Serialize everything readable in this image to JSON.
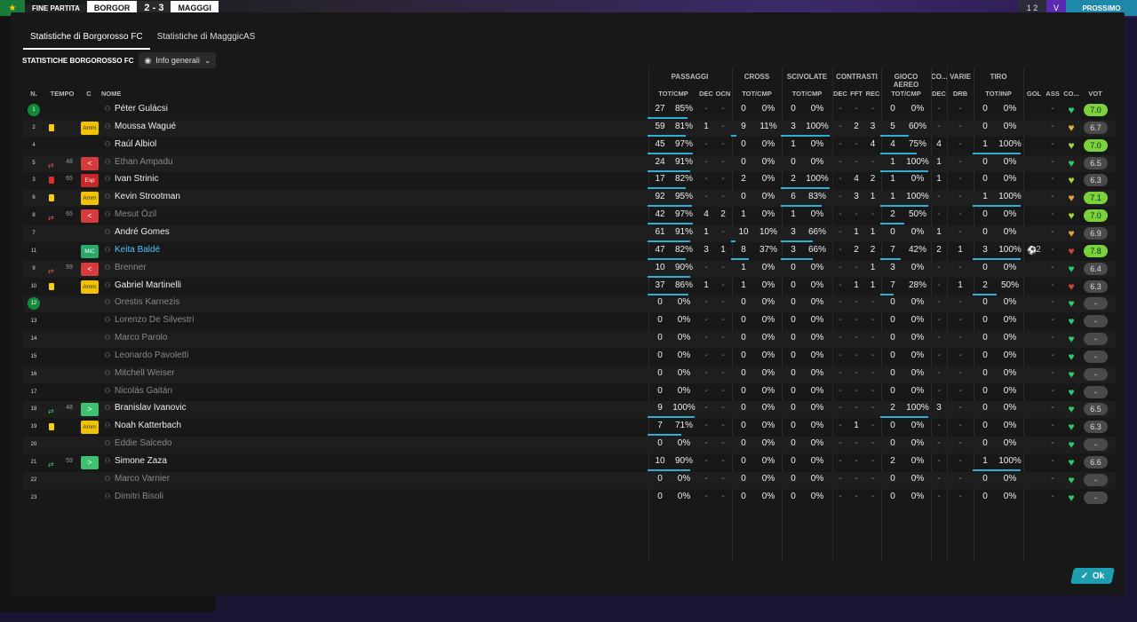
{
  "topbar": {
    "end_label": "FINE PARTITA",
    "home_team": "BORGOR",
    "score": "2 - 3",
    "away_team": "MAGGGI",
    "right_a": "1 2",
    "right_b": "V",
    "right_c": "PROSSIMO"
  },
  "tabs": [
    {
      "label": "Statistiche di Borgorosso FC"
    },
    {
      "label": "Statistiche di MagggicAS"
    }
  ],
  "section_title": "STATISTICHE BORGOROSSO FC",
  "view_dropdown": {
    "selected": "Info generali"
  },
  "groups": {
    "passaggi": "PASSAGGI",
    "cross": "CROSS",
    "scivolate": "SCIVOLATE",
    "contrasti": "CONTRASTI",
    "aereo": "GIOCO AEREO",
    "co": "CO...",
    "varie": "VARIE",
    "tiro": "TIRO"
  },
  "headers": {
    "n": "N.",
    "tempo": "TEMPO",
    "c": "C",
    "nome": "NOME",
    "pass_tot": "TOT/CMP",
    "pass_dec": "DEC",
    "pass_ocn": "OCN",
    "cross_tot": "TOT/CMP",
    "sciv_tot": "TOT/CMP",
    "con_dec": "DEC",
    "con_fft": "FFT",
    "con_rec": "REC",
    "aer_tot": "TOT/CMP",
    "co_dec": "DEC",
    "var_drb": "DRB",
    "tiro_tot": "TOT/INP",
    "gol": "GOL",
    "ass": "ASS",
    "co": "CO...",
    "vot": "VOT"
  },
  "ok_label": "Ok",
  "players": [
    {
      "n": "1",
      "starter": true,
      "card": "",
      "min": "",
      "badge": "",
      "badge_label": "",
      "name": "Péter Gulácsi",
      "dim": false,
      "link": false,
      "p_tot": "27",
      "p_pct": "85%",
      "p_dec": "-",
      "p_ocn": "-",
      "c_tot": "0",
      "c_pct": "0%",
      "s_tot": "0",
      "s_pct": "0%",
      "k_dec": "-",
      "k_fft": "-",
      "k_rec": "-",
      "a_tot": "0",
      "a_pct": "0%",
      "co": "-",
      "drb": "-",
      "t_tot": "0",
      "t_pct": "0%",
      "gol": "",
      "ass": "-",
      "heart": "green",
      "rating": "7.0",
      "rt": "green"
    },
    {
      "n": "2",
      "starter": false,
      "card": "y",
      "min": "",
      "badge": "amm",
      "badge_label": "Amm",
      "name": "Moussa Wagué",
      "dim": false,
      "link": false,
      "p_tot": "59",
      "p_pct": "81%",
      "p_dec": "1",
      "p_ocn": "-",
      "c_tot": "9",
      "c_pct": "11%",
      "s_tot": "3",
      "s_pct": "100%",
      "k_dec": "-",
      "k_fft": "2",
      "k_rec": "3",
      "a_tot": "5",
      "a_pct": "60%",
      "co": "-",
      "drb": "-",
      "t_tot": "0",
      "t_pct": "0%",
      "gol": "",
      "ass": "-",
      "heart": "yellow",
      "rating": "6.7",
      "rt": "grey"
    },
    {
      "n": "4",
      "starter": false,
      "card": "",
      "min": "",
      "badge": "",
      "badge_label": "",
      "name": "Raúl Albiol",
      "dim": false,
      "link": false,
      "p_tot": "45",
      "p_pct": "97%",
      "p_dec": "-",
      "p_ocn": "-",
      "c_tot": "0",
      "c_pct": "0%",
      "s_tot": "1",
      "s_pct": "0%",
      "k_dec": "-",
      "k_fft": "-",
      "k_rec": "4",
      "a_tot": "4",
      "a_pct": "75%",
      "co": "4",
      "drb": "-",
      "t_tot": "1",
      "t_pct": "100%",
      "gol": "",
      "ass": "-",
      "heart": "lime",
      "rating": "7.0",
      "rt": "green"
    },
    {
      "n": "5",
      "starter": false,
      "card": "",
      "min": "48",
      "swap": "out",
      "badge": "out",
      "badge_label": "<",
      "name": "Ethan Ampadu",
      "dim": true,
      "link": false,
      "p_tot": "24",
      "p_pct": "91%",
      "p_dec": "-",
      "p_ocn": "-",
      "c_tot": "0",
      "c_pct": "0%",
      "s_tot": "0",
      "s_pct": "0%",
      "k_dec": "-",
      "k_fft": "-",
      "k_rec": "-",
      "a_tot": "1",
      "a_pct": "100%",
      "co": "1",
      "drb": "-",
      "t_tot": "0",
      "t_pct": "0%",
      "gol": "",
      "ass": "-",
      "heart": "green",
      "rating": "6.5",
      "rt": "grey"
    },
    {
      "n": "3",
      "starter": false,
      "card": "r",
      "min": "65",
      "badge": "esp",
      "badge_label": "Esp",
      "name": "Ivan Strinic",
      "dim": false,
      "link": false,
      "p_tot": "17",
      "p_pct": "82%",
      "p_dec": "-",
      "p_ocn": "-",
      "c_tot": "2",
      "c_pct": "0%",
      "s_tot": "2",
      "s_pct": "100%",
      "k_dec": "-",
      "k_fft": "4",
      "k_rec": "2",
      "a_tot": "1",
      "a_pct": "0%",
      "co": "1",
      "drb": "-",
      "t_tot": "0",
      "t_pct": "0%",
      "gol": "",
      "ass": "-",
      "heart": "lime",
      "rating": "6.3",
      "rt": "grey"
    },
    {
      "n": "6",
      "starter": false,
      "card": "y",
      "min": "",
      "badge": "amm",
      "badge_label": "Amm",
      "name": "Kevin Strootman",
      "dim": false,
      "link": false,
      "p_tot": "92",
      "p_pct": "95%",
      "p_dec": "-",
      "p_ocn": "-",
      "c_tot": "0",
      "c_pct": "0%",
      "s_tot": "6",
      "s_pct": "83%",
      "k_dec": "-",
      "k_fft": "3",
      "k_rec": "1",
      "a_tot": "1",
      "a_pct": "100%",
      "co": "-",
      "drb": "-",
      "t_tot": "1",
      "t_pct": "100%",
      "gol": "",
      "ass": "-",
      "heart": "orange",
      "rating": "7.1",
      "rt": "green"
    },
    {
      "n": "8",
      "starter": false,
      "card": "",
      "min": "65",
      "swap": "out",
      "badge": "out",
      "badge_label": "<",
      "name": "Mesut Özil",
      "dim": true,
      "link": false,
      "p_tot": "42",
      "p_pct": "97%",
      "p_dec": "4",
      "p_ocn": "2",
      "c_tot": "1",
      "c_pct": "0%",
      "s_tot": "1",
      "s_pct": "0%",
      "k_dec": "-",
      "k_fft": "-",
      "k_rec": "-",
      "a_tot": "2",
      "a_pct": "50%",
      "co": "-",
      "drb": "-",
      "t_tot": "0",
      "t_pct": "0%",
      "gol": "",
      "ass": "-",
      "heart": "lime",
      "rating": "7.0",
      "rt": "green"
    },
    {
      "n": "7",
      "starter": false,
      "card": "",
      "min": "",
      "badge": "",
      "badge_label": "",
      "name": "André Gomes",
      "dim": false,
      "link": false,
      "p_tot": "61",
      "p_pct": "91%",
      "p_dec": "1",
      "p_ocn": "-",
      "c_tot": "10",
      "c_pct": "10%",
      "s_tot": "3",
      "s_pct": "66%",
      "k_dec": "-",
      "k_fft": "1",
      "k_rec": "1",
      "a_tot": "0",
      "a_pct": "0%",
      "co": "1",
      "drb": "-",
      "t_tot": "0",
      "t_pct": "0%",
      "gol": "",
      "ass": "-",
      "heart": "orange",
      "rating": "6.9",
      "rt": "grey"
    },
    {
      "n": "11",
      "starter": false,
      "card": "",
      "min": "",
      "badge": "mic",
      "badge_label": "MiC",
      "name": "Keita Baldé",
      "dim": false,
      "link": true,
      "p_tot": "47",
      "p_pct": "82%",
      "p_dec": "3",
      "p_ocn": "1",
      "c_tot": "8",
      "c_pct": "37%",
      "s_tot": "3",
      "s_pct": "66%",
      "k_dec": "-",
      "k_fft": "2",
      "k_rec": "2",
      "a_tot": "7",
      "a_pct": "42%",
      "co": "2",
      "drb": "1",
      "t_tot": "3",
      "t_pct": "100%",
      "gol": "2",
      "ass": "-",
      "heart": "red",
      "rating": "7.8",
      "rt": "green"
    },
    {
      "n": "9",
      "starter": false,
      "card": "",
      "min": "59",
      "swap": "out",
      "badge": "out",
      "badge_label": "<",
      "name": "Brenner",
      "dim": true,
      "link": false,
      "p_tot": "10",
      "p_pct": "90%",
      "p_dec": "-",
      "p_ocn": "-",
      "c_tot": "1",
      "c_pct": "0%",
      "s_tot": "0",
      "s_pct": "0%",
      "k_dec": "-",
      "k_fft": "-",
      "k_rec": "1",
      "a_tot": "3",
      "a_pct": "0%",
      "co": "-",
      "drb": "-",
      "t_tot": "0",
      "t_pct": "0%",
      "gol": "",
      "ass": "-",
      "heart": "green",
      "rating": "6.4",
      "rt": "grey"
    },
    {
      "n": "10",
      "starter": false,
      "card": "y",
      "min": "",
      "badge": "amm",
      "badge_label": "Amm",
      "name": "Gabriel Martinelli",
      "dim": false,
      "link": false,
      "p_tot": "37",
      "p_pct": "86%",
      "p_dec": "1",
      "p_ocn": "-",
      "c_tot": "1",
      "c_pct": "0%",
      "s_tot": "0",
      "s_pct": "0%",
      "k_dec": "-",
      "k_fft": "1",
      "k_rec": "1",
      "a_tot": "7",
      "a_pct": "28%",
      "co": "-",
      "drb": "1",
      "t_tot": "2",
      "t_pct": "50%",
      "gol": "",
      "ass": "-",
      "heart": "red",
      "rating": "6.3",
      "rt": "grey"
    },
    {
      "n": "12",
      "starter": true,
      "card": "",
      "min": "",
      "badge": "",
      "badge_label": "",
      "name": "Orestis Karnezis",
      "dim": true,
      "link": false,
      "p_tot": "0",
      "p_pct": "0%",
      "p_dec": "-",
      "p_ocn": "-",
      "c_tot": "0",
      "c_pct": "0%",
      "s_tot": "0",
      "s_pct": "0%",
      "k_dec": "-",
      "k_fft": "-",
      "k_rec": "-",
      "a_tot": "0",
      "a_pct": "0%",
      "co": "-",
      "drb": "-",
      "t_tot": "0",
      "t_pct": "0%",
      "gol": "",
      "ass": "-",
      "heart": "green",
      "rating": "-",
      "rt": "grey"
    },
    {
      "n": "13",
      "starter": false,
      "card": "",
      "min": "",
      "badge": "",
      "badge_label": "",
      "name": "Lorenzo De Silvestri",
      "dim": true,
      "link": false,
      "p_tot": "0",
      "p_pct": "0%",
      "p_dec": "-",
      "p_ocn": "-",
      "c_tot": "0",
      "c_pct": "0%",
      "s_tot": "0",
      "s_pct": "0%",
      "k_dec": "-",
      "k_fft": "-",
      "k_rec": "-",
      "a_tot": "0",
      "a_pct": "0%",
      "co": "-",
      "drb": "-",
      "t_tot": "0",
      "t_pct": "0%",
      "gol": "",
      "ass": "-",
      "heart": "green",
      "rating": "-",
      "rt": "grey"
    },
    {
      "n": "14",
      "starter": false,
      "card": "",
      "min": "",
      "badge": "",
      "badge_label": "",
      "name": "Marco Parolo",
      "dim": true,
      "link": false,
      "p_tot": "0",
      "p_pct": "0%",
      "p_dec": "-",
      "p_ocn": "-",
      "c_tot": "0",
      "c_pct": "0%",
      "s_tot": "0",
      "s_pct": "0%",
      "k_dec": "-",
      "k_fft": "-",
      "k_rec": "-",
      "a_tot": "0",
      "a_pct": "0%",
      "co": "-",
      "drb": "-",
      "t_tot": "0",
      "t_pct": "0%",
      "gol": "",
      "ass": "-",
      "heart": "green",
      "rating": "-",
      "rt": "grey"
    },
    {
      "n": "15",
      "starter": false,
      "card": "",
      "min": "",
      "badge": "",
      "badge_label": "",
      "name": "Leonardo Pavoletti",
      "dim": true,
      "link": false,
      "p_tot": "0",
      "p_pct": "0%",
      "p_dec": "-",
      "p_ocn": "-",
      "c_tot": "0",
      "c_pct": "0%",
      "s_tot": "0",
      "s_pct": "0%",
      "k_dec": "-",
      "k_fft": "-",
      "k_rec": "-",
      "a_tot": "0",
      "a_pct": "0%",
      "co": "-",
      "drb": "-",
      "t_tot": "0",
      "t_pct": "0%",
      "gol": "",
      "ass": "-",
      "heart": "green",
      "rating": "-",
      "rt": "grey"
    },
    {
      "n": "16",
      "starter": false,
      "card": "",
      "min": "",
      "badge": "",
      "badge_label": "",
      "name": "Mitchell Weiser",
      "dim": true,
      "link": false,
      "p_tot": "0",
      "p_pct": "0%",
      "p_dec": "-",
      "p_ocn": "-",
      "c_tot": "0",
      "c_pct": "0%",
      "s_tot": "0",
      "s_pct": "0%",
      "k_dec": "-",
      "k_fft": "-",
      "k_rec": "-",
      "a_tot": "0",
      "a_pct": "0%",
      "co": "-",
      "drb": "-",
      "t_tot": "0",
      "t_pct": "0%",
      "gol": "",
      "ass": "-",
      "heart": "green",
      "rating": "-",
      "rt": "grey"
    },
    {
      "n": "17",
      "starter": false,
      "card": "",
      "min": "",
      "badge": "",
      "badge_label": "",
      "name": "Nicolás Gaitán",
      "dim": true,
      "link": false,
      "p_tot": "0",
      "p_pct": "0%",
      "p_dec": "-",
      "p_ocn": "-",
      "c_tot": "0",
      "c_pct": "0%",
      "s_tot": "0",
      "s_pct": "0%",
      "k_dec": "-",
      "k_fft": "-",
      "k_rec": "-",
      "a_tot": "0",
      "a_pct": "0%",
      "co": "-",
      "drb": "-",
      "t_tot": "0",
      "t_pct": "0%",
      "gol": "",
      "ass": "-",
      "heart": "green",
      "rating": "-",
      "rt": "grey"
    },
    {
      "n": "18",
      "starter": false,
      "card": "",
      "min": "48",
      "swap": "in",
      "badge": "in",
      "badge_label": ">",
      "name": "Branislav Ivanovic",
      "dim": false,
      "link": false,
      "p_tot": "9",
      "p_pct": "100%",
      "p_dec": "-",
      "p_ocn": "-",
      "c_tot": "0",
      "c_pct": "0%",
      "s_tot": "0",
      "s_pct": "0%",
      "k_dec": "-",
      "k_fft": "-",
      "k_rec": "-",
      "a_tot": "2",
      "a_pct": "100%",
      "co": "3",
      "drb": "-",
      "t_tot": "0",
      "t_pct": "0%",
      "gol": "",
      "ass": "-",
      "heart": "green",
      "rating": "6.5",
      "rt": "grey"
    },
    {
      "n": "19",
      "starter": false,
      "card": "y",
      "min": "",
      "badge": "amm",
      "badge_label": "Amm",
      "name": "Noah Katterbach",
      "dim": false,
      "link": false,
      "p_tot": "7",
      "p_pct": "71%",
      "p_dec": "-",
      "p_ocn": "-",
      "c_tot": "0",
      "c_pct": "0%",
      "s_tot": "0",
      "s_pct": "0%",
      "k_dec": "-",
      "k_fft": "1",
      "k_rec": "-",
      "a_tot": "0",
      "a_pct": "0%",
      "co": "-",
      "drb": "-",
      "t_tot": "0",
      "t_pct": "0%",
      "gol": "",
      "ass": "-",
      "heart": "green",
      "rating": "6.3",
      "rt": "grey"
    },
    {
      "n": "20",
      "starter": false,
      "card": "",
      "min": "",
      "badge": "",
      "badge_label": "",
      "name": "Eddie Salcedo",
      "dim": true,
      "link": false,
      "p_tot": "0",
      "p_pct": "0%",
      "p_dec": "-",
      "p_ocn": "-",
      "c_tot": "0",
      "c_pct": "0%",
      "s_tot": "0",
      "s_pct": "0%",
      "k_dec": "-",
      "k_fft": "-",
      "k_rec": "-",
      "a_tot": "0",
      "a_pct": "0%",
      "co": "-",
      "drb": "-",
      "t_tot": "0",
      "t_pct": "0%",
      "gol": "",
      "ass": "-",
      "heart": "green",
      "rating": "-",
      "rt": "grey"
    },
    {
      "n": "21",
      "starter": false,
      "card": "",
      "min": "59",
      "swap": "in",
      "badge": "in",
      "badge_label": ">",
      "name": "Simone Zaza",
      "dim": false,
      "link": false,
      "p_tot": "10",
      "p_pct": "90%",
      "p_dec": "-",
      "p_ocn": "-",
      "c_tot": "0",
      "c_pct": "0%",
      "s_tot": "0",
      "s_pct": "0%",
      "k_dec": "-",
      "k_fft": "-",
      "k_rec": "-",
      "a_tot": "2",
      "a_pct": "0%",
      "co": "-",
      "drb": "-",
      "t_tot": "1",
      "t_pct": "100%",
      "gol": "",
      "ass": "-",
      "heart": "green",
      "rating": "6.6",
      "rt": "grey"
    },
    {
      "n": "22",
      "starter": false,
      "card": "",
      "min": "",
      "badge": "",
      "badge_label": "",
      "name": "Marco Varnier",
      "dim": true,
      "link": false,
      "p_tot": "0",
      "p_pct": "0%",
      "p_dec": "-",
      "p_ocn": "-",
      "c_tot": "0",
      "c_pct": "0%",
      "s_tot": "0",
      "s_pct": "0%",
      "k_dec": "-",
      "k_fft": "-",
      "k_rec": "-",
      "a_tot": "0",
      "a_pct": "0%",
      "co": "-",
      "drb": "-",
      "t_tot": "0",
      "t_pct": "0%",
      "gol": "",
      "ass": "-",
      "heart": "green",
      "rating": "-",
      "rt": "grey"
    },
    {
      "n": "23",
      "starter": false,
      "card": "",
      "min": "",
      "badge": "",
      "badge_label": "",
      "name": "Dimitri Bisoli",
      "dim": true,
      "link": false,
      "p_tot": "0",
      "p_pct": "0%",
      "p_dec": "-",
      "p_ocn": "-",
      "c_tot": "0",
      "c_pct": "0%",
      "s_tot": "0",
      "s_pct": "0%",
      "k_dec": "-",
      "k_fft": "-",
      "k_rec": "-",
      "a_tot": "0",
      "a_pct": "0%",
      "co": "-",
      "drb": "-",
      "t_tot": "0",
      "t_pct": "0%",
      "gol": "",
      "ass": "-",
      "heart": "green",
      "rating": "-",
      "rt": "grey"
    }
  ],
  "colors": {
    "accent": "#2eb0d6",
    "rating_green": "#7ad23a",
    "heart_green": "#2ecc71",
    "heart_lime": "#a6d63a",
    "heart_yellow": "#e0b13a",
    "heart_orange": "#e8a33a",
    "heart_red": "#c9463a"
  }
}
